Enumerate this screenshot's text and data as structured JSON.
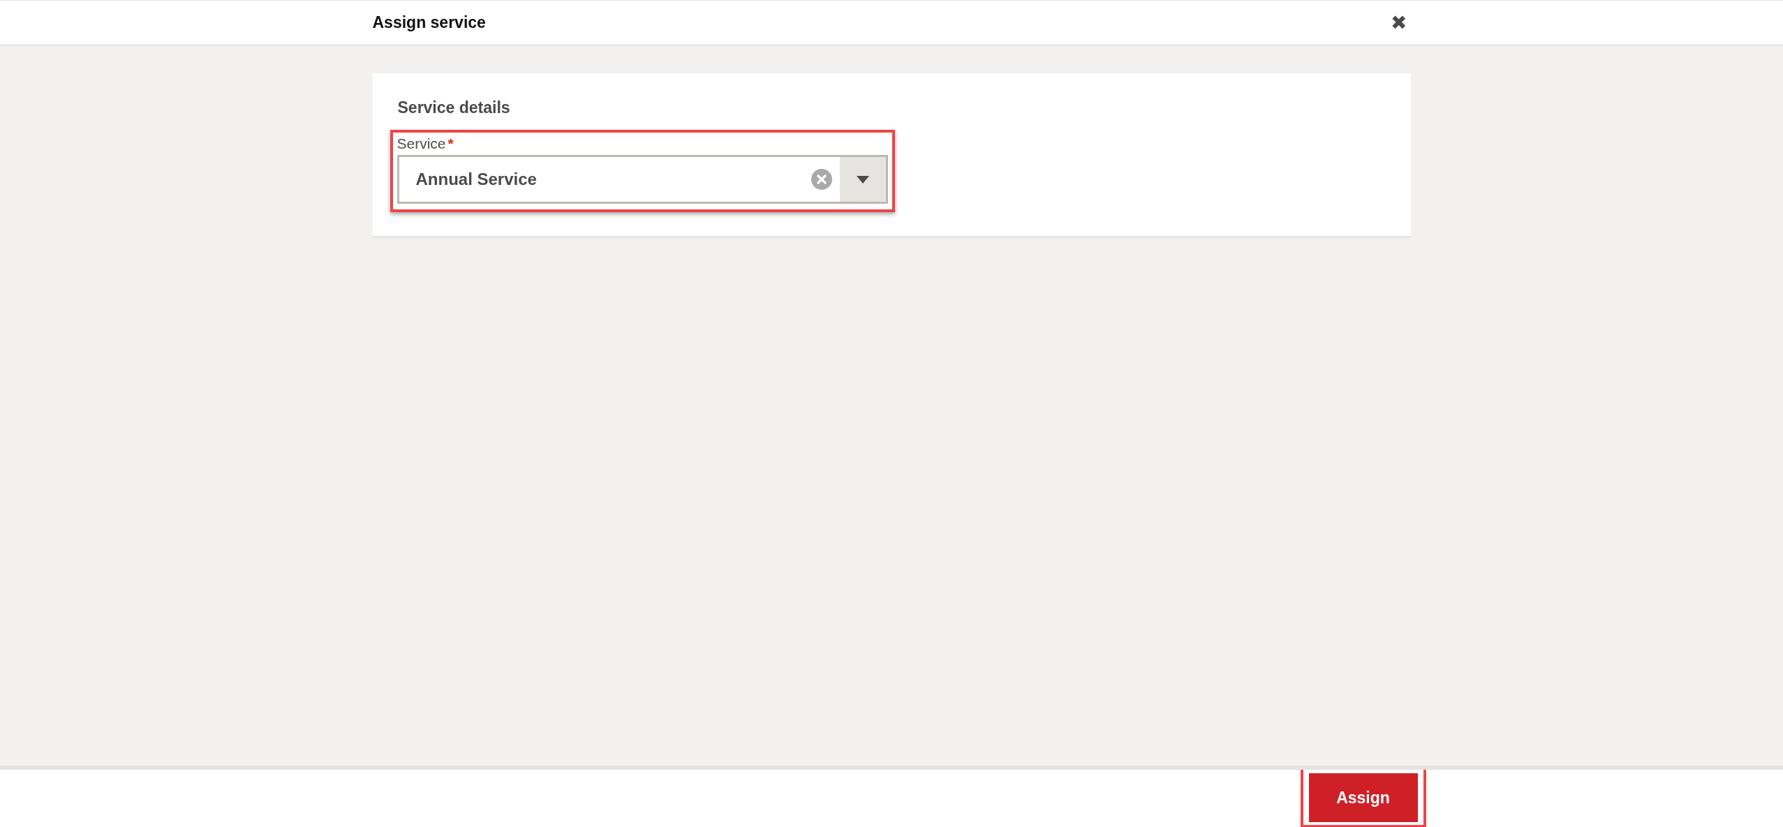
{
  "header": {
    "title": "Assign service",
    "close_symbol": "✖"
  },
  "card": {
    "title": "Service details",
    "field": {
      "label": "Service",
      "required_mark": "*",
      "value": "Annual Service",
      "highlighted": true
    }
  },
  "footer": {
    "button": {
      "label": "Assign",
      "highlighted": true
    }
  }
}
